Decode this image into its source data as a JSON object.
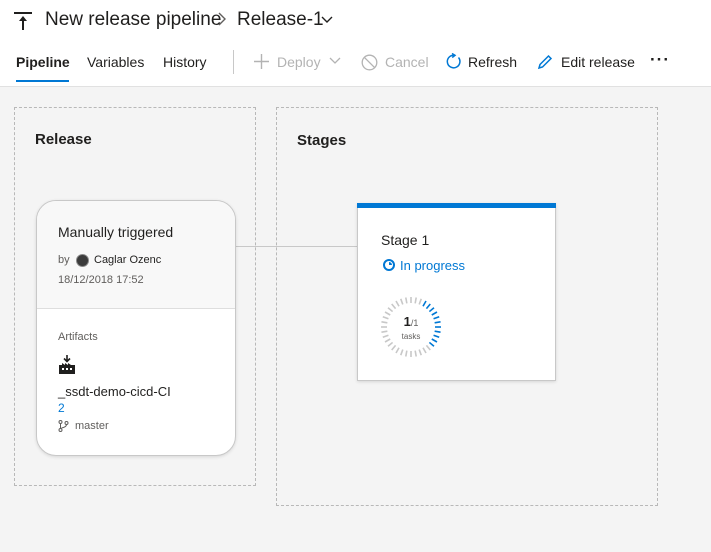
{
  "header": {
    "pipeline_name": "New release pipeline",
    "release_name": "Release-1",
    "icons": [
      "pipeline-icon",
      "chevron-right-icon",
      "chevron-down-icon"
    ]
  },
  "tabs": [
    {
      "label": "Pipeline",
      "active": true
    },
    {
      "label": "Variables",
      "active": false
    },
    {
      "label": "History",
      "active": false
    }
  ],
  "toolbar": {
    "deploy_label": "Deploy",
    "cancel_label": "Cancel",
    "refresh_label": "Refresh",
    "edit_label": "Edit release",
    "more_label": "···"
  },
  "release_panel": {
    "title": "Release",
    "card": {
      "trigger": "Manually triggered",
      "by_label": "by",
      "user": "Caglar Ozenc",
      "date": "18/12/2018 17:52",
      "artifacts_label": "Artifacts",
      "artifact_name": "_ssdt-demo-cicd-CI",
      "artifact_version": "2",
      "artifact_branch": "master"
    }
  },
  "stages_panel": {
    "title": "Stages",
    "stage": {
      "name": "Stage 1",
      "status": "In progress",
      "tasks_done": "1",
      "tasks_total": "/1",
      "tasks_label": "tasks"
    }
  },
  "colors": {
    "accent": "#0078d4",
    "disabled": "#b3b3b3",
    "panel_border": "#b8b8b8"
  }
}
